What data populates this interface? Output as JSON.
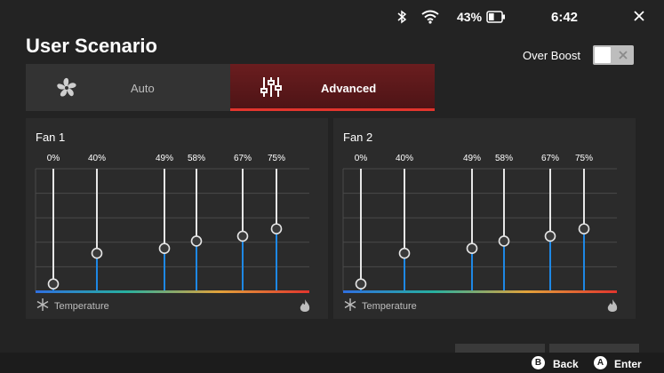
{
  "status": {
    "battery_percent": "43%",
    "battery_level": 0.43,
    "time": "6:42",
    "icons": [
      "bluetooth-icon",
      "wifi-icon",
      "battery-icon",
      "close-icon"
    ]
  },
  "page": {
    "title": "User Scenario"
  },
  "over_boost": {
    "label": "Over Boost",
    "enabled": false
  },
  "tabs": [
    {
      "label": "Auto",
      "icon": "fan-icon",
      "active": false
    },
    {
      "label": "Advanced",
      "icon": "sliders-icon",
      "active": true
    }
  ],
  "colors": {
    "accent": "#e2352d",
    "curve_blue": "#1e88e5",
    "gradient": [
      "#2f6fe0",
      "#27b0a0",
      "#e2a23a",
      "#e2352d"
    ]
  },
  "fans": [
    {
      "name": "Fan 1",
      "temperature_label": "Temperature",
      "points": [
        {
          "label": "0%",
          "level": 0.06
        },
        {
          "label": "40%",
          "level": 0.31
        },
        {
          "label": "49%",
          "level": 0.35
        },
        {
          "label": "58%",
          "level": 0.41
        },
        {
          "label": "67%",
          "level": 0.45
        },
        {
          "label": "75%",
          "level": 0.51
        }
      ]
    },
    {
      "name": "Fan 2",
      "temperature_label": "Temperature",
      "points": [
        {
          "label": "0%",
          "level": 0.06
        },
        {
          "label": "40%",
          "level": 0.31
        },
        {
          "label": "49%",
          "level": 0.35
        },
        {
          "label": "58%",
          "level": 0.41
        },
        {
          "label": "67%",
          "level": 0.45
        },
        {
          "label": "75%",
          "level": 0.51
        }
      ]
    }
  ],
  "footer": {
    "back_key": "B",
    "back_label": "Back",
    "enter_key": "A",
    "enter_label": "Enter"
  }
}
